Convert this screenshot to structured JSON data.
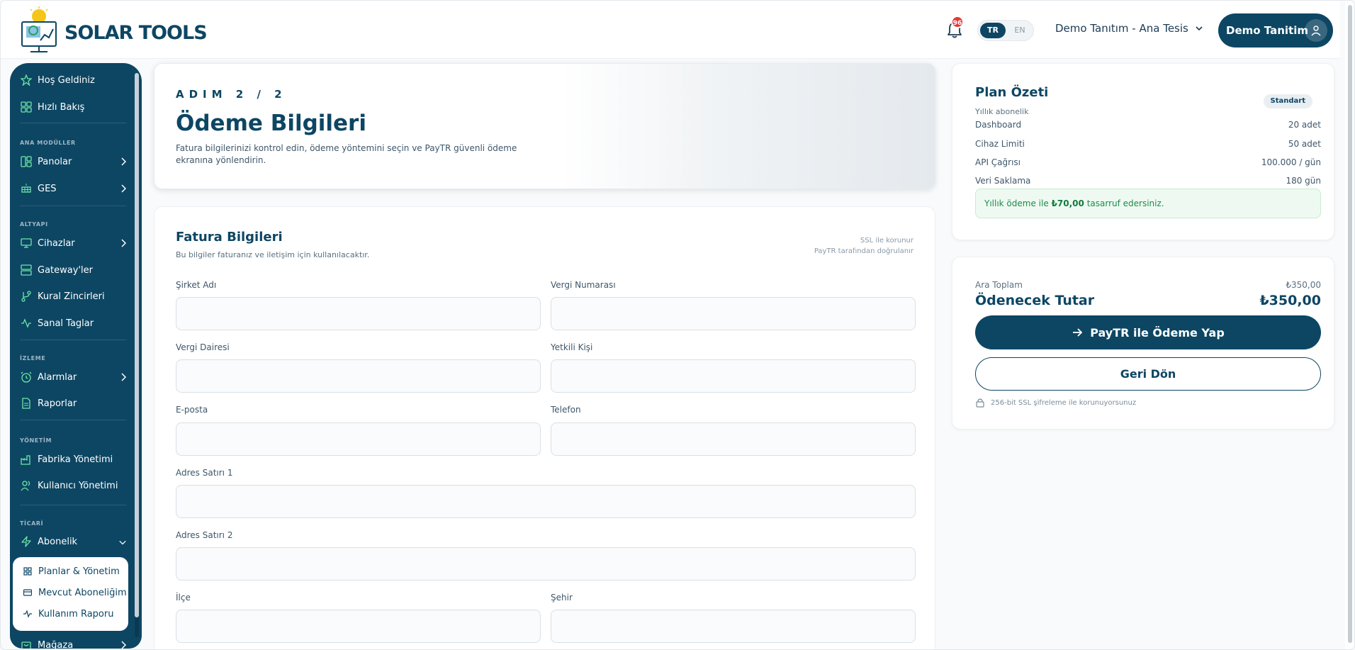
{
  "header": {
    "brand": "SOLAR TOOLS",
    "notification_count": "96",
    "lang_active": "TR",
    "lang_other": "EN",
    "tenant": "Demo Tanıtım - Ana Tesis",
    "user": "Demo Tanitim"
  },
  "sidebar": {
    "top_items": [
      {
        "label": "Hoş Geldiniz",
        "icon": "star-icon"
      },
      {
        "label": "Hızlı Bakış",
        "icon": "grid-icon"
      }
    ],
    "sections": {
      "modules": "ANA MODÜLLER",
      "infra": "ALTYAPI",
      "monitoring": "İZLEME",
      "management": "YÖNETİM",
      "commercial": "TİCARİ"
    },
    "items": {
      "panolar": "Panolar",
      "ges": "GES",
      "cihazlar": "Cihazlar",
      "gateways": "Gateway'ler",
      "kural": "Kural Zincirleri",
      "sanal": "Sanal Taglar",
      "alarmlar": "Alarmlar",
      "raporlar": "Raporlar",
      "fabrika": "Fabrika Yönetimi",
      "kullanici": "Kullanıcı Yönetimi",
      "abonelik": "Abonelik",
      "magaza": "Mağaza"
    },
    "submenu": [
      {
        "label": "Planlar & Yönetim",
        "icon": "grid-icon"
      },
      {
        "label": "Mevcut Aboneliğim",
        "icon": "card-icon"
      },
      {
        "label": "Kullanım Raporu",
        "icon": "activity-icon"
      }
    ]
  },
  "hero": {
    "step": "ADIM 2 / 2",
    "title": "Ödeme Bilgileri",
    "description": "Fatura bilgilerinizi kontrol edin, ödeme yöntemini seçin ve PayTR güvenli ödeme ekranına yönlendirin."
  },
  "form": {
    "title": "Fatura Bilgileri",
    "subtitle": "Bu bilgiler faturanız ve iletişim için kullanılacaktır.",
    "ssl_line1": "SSL ile korunur",
    "ssl_line2": "PayTR tarafından doğrulanır",
    "fields": {
      "company": {
        "label": "Şirket Adı",
        "value": ""
      },
      "tax_no": {
        "label": "Vergi Numarası",
        "value": ""
      },
      "tax_office": {
        "label": "Vergi Dairesi",
        "value": ""
      },
      "contact": {
        "label": "Yetkili Kişi",
        "value": ""
      },
      "email": {
        "label": "E-posta",
        "value": ""
      },
      "phone": {
        "label": "Telefon",
        "value": ""
      },
      "address1": {
        "label": "Adres Satırı 1",
        "value": ""
      },
      "address2": {
        "label": "Adres Satırı 2",
        "value": ""
      },
      "district": {
        "label": "İlçe",
        "value": ""
      },
      "city": {
        "label": "Şehir",
        "value": ""
      }
    }
  },
  "plan": {
    "title": "Plan Özeti",
    "billing": "Yıllık abonelik",
    "badge": "Standart",
    "rows": [
      {
        "label": "Dashboard",
        "value": "20 adet"
      },
      {
        "label": "Cihaz Limiti",
        "value": "50 adet"
      },
      {
        "label": "API Çağrısı",
        "value": "100.000 / gün"
      },
      {
        "label": "Veri Saklama",
        "value": "180 gün"
      }
    ],
    "saving_prefix": "Yıllık ödeme ile",
    "saving_amount": "₺70,00",
    "saving_suffix": "tasarruf edersiniz."
  },
  "payment": {
    "subtotal_label": "Ara Toplam",
    "subtotal_value": "₺350,00",
    "total_label": "Ödenecek Tutar",
    "total_value": "₺350,00",
    "pay_button": "PayTR ile Ödeme Yap",
    "back_button": "Geri Dön",
    "secure_note": "256-bit SSL şifreleme ile korunuyorsunuz"
  }
}
